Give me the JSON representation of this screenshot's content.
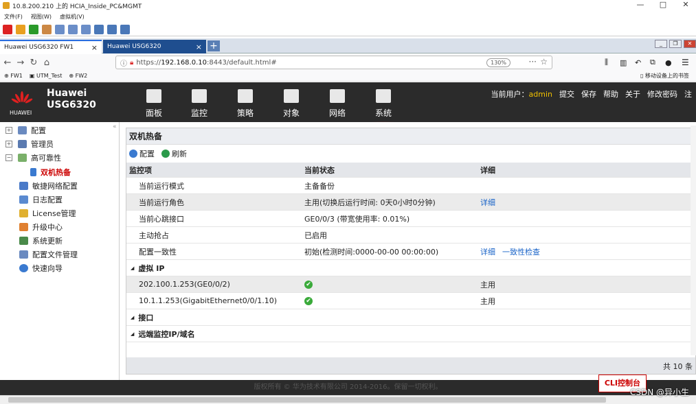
{
  "vm_window": {
    "title": "10.8.200.210 上的 HCIA_Inside_PC&MGMT",
    "menu": [
      "文件(F)",
      "视图(W)",
      "虚拟机(V)"
    ],
    "minimize": "—",
    "maximize": "□",
    "close": "✕"
  },
  "browser": {
    "tabs": [
      {
        "label": "Huawei USG6320 FW1",
        "active": true
      },
      {
        "label": "Huawei USG6320",
        "active": false
      }
    ],
    "new_tab": "+",
    "url_prefix": "https://",
    "url_host": "192.168.0.10",
    "url_rest": ":8443/default.html#",
    "zoom": "130%",
    "bookmarks": [
      "FW1",
      "UTM_Test",
      "FW2"
    ],
    "mobile_bookmarks": "移动设备上的书签"
  },
  "app": {
    "brand_line1": "Huawei",
    "brand_line2": "USG6320",
    "logo_text": "HUAWEI",
    "nav": [
      {
        "label": "面板",
        "icon": "dashboard-icon"
      },
      {
        "label": "监控",
        "icon": "monitor-chart-icon"
      },
      {
        "label": "策略",
        "icon": "policy-doc-icon"
      },
      {
        "label": "对象",
        "icon": "object-icon"
      },
      {
        "label": "网络",
        "icon": "network-icon"
      },
      {
        "label": "系统",
        "icon": "system-screen-icon",
        "active": true
      }
    ],
    "user_label": "当前用户：",
    "user_name": "admin",
    "actions": [
      "提交",
      "保存",
      "帮助",
      "关于",
      "修改密码",
      "注"
    ]
  },
  "sidebar": {
    "items": [
      {
        "label": "配置",
        "expand": "+"
      },
      {
        "label": "管理员",
        "expand": "+"
      },
      {
        "label": "高可靠性",
        "expand": "−"
      },
      {
        "label": "双机热备",
        "selected": true
      },
      {
        "label": "敏捷网络配置"
      },
      {
        "label": "日志配置"
      },
      {
        "label": "License管理"
      },
      {
        "label": "升级中心"
      },
      {
        "label": "系统更新"
      },
      {
        "label": "配置文件管理"
      },
      {
        "label": "快速向导"
      }
    ],
    "collapse_glyph": "«"
  },
  "panel": {
    "title": "双机热备",
    "toolbar": {
      "config": "配置",
      "refresh": "刷新"
    },
    "headers": {
      "item": "监控项",
      "status": "当前状态",
      "detail": "详细"
    },
    "rows": [
      {
        "item": "当前运行模式",
        "status": "主备备份",
        "detail": ""
      },
      {
        "item": "当前运行角色",
        "status": "主用(切换后运行时间: 0天0小时0分钟)",
        "detail": "详细"
      },
      {
        "item": "当前心跳接口",
        "status": "GE0/0/3 (带宽使用率: 0.01%)",
        "detail": ""
      },
      {
        "item": "主动抢占",
        "status": "已启用",
        "detail": ""
      },
      {
        "item": "配置一致性",
        "status": "初始(检测时间:0000-00-00 00:00:00)",
        "detail": "详细",
        "detail2": "一致性检查"
      }
    ],
    "group_vip": "虚拟 IP",
    "vip_rows": [
      {
        "item": "202.100.1.253(GE0/0/2)",
        "detail": "主用"
      },
      {
        "item": "10.1.1.253(GigabitEthernet0/0/1.10)",
        "detail": "主用"
      }
    ],
    "ok_glyph": "✔",
    "group_intf": "接口",
    "group_remote": "远端监控IP/域名",
    "footer_total": "共 10 条"
  },
  "cli_button": "CLI控制台",
  "copyright": "版权所有 © 华为技术有限公司 2014-2016。保留一切权利。",
  "watermark": "CSDN @异小生"
}
